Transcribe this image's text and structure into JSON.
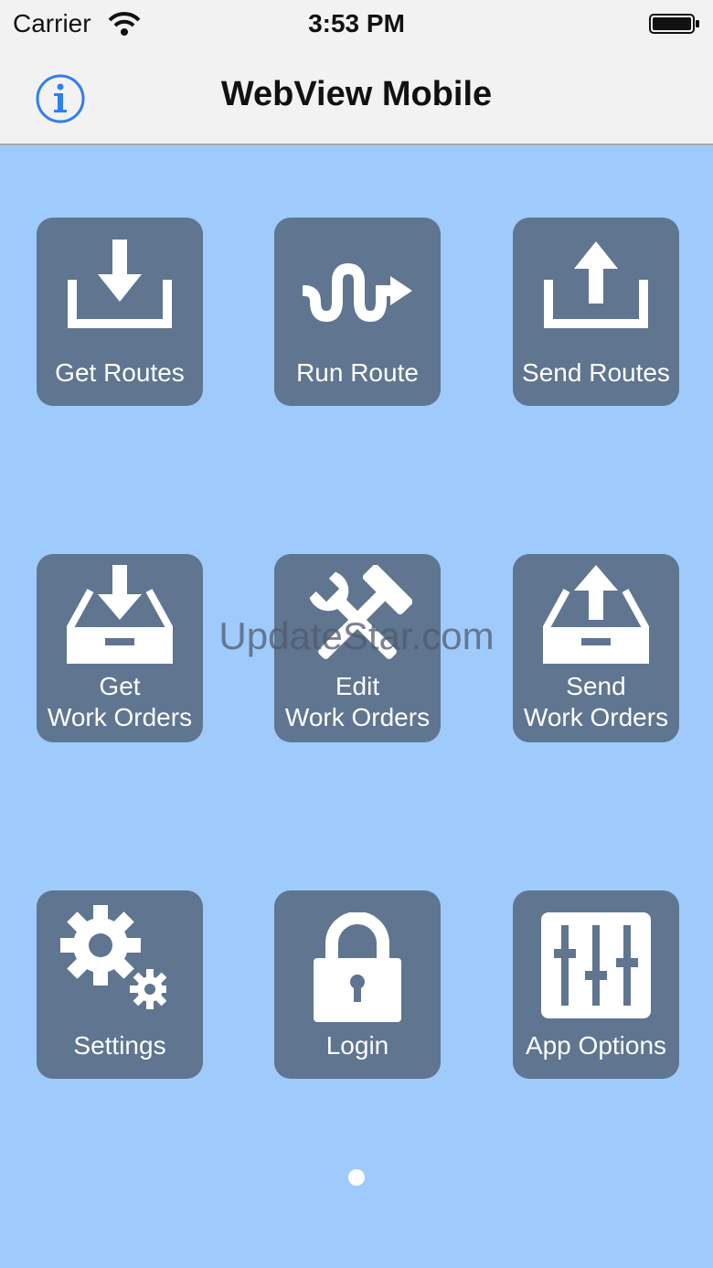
{
  "status_bar": {
    "carrier": "Carrier",
    "time": "3:53 PM",
    "wifi_icon": "wifi-icon",
    "battery_icon": "battery-icon"
  },
  "nav_bar": {
    "title": "WebView Mobile",
    "info_icon": "info-icon"
  },
  "tiles": [
    {
      "id": "get-routes",
      "line1": "Get Routes",
      "line2": "",
      "icon": "download-tray-icon"
    },
    {
      "id": "run-route",
      "line1": "Run Route",
      "line2": "",
      "icon": "route-arrow-icon"
    },
    {
      "id": "send-routes",
      "line1": "Send Routes",
      "line2": "",
      "icon": "upload-tray-icon"
    },
    {
      "id": "get-work-orders",
      "line1": "Get",
      "line2": "Work Orders",
      "icon": "inbox-download-icon"
    },
    {
      "id": "edit-work-orders",
      "line1": "Edit",
      "line2": "Work Orders",
      "icon": "tools-icon"
    },
    {
      "id": "send-work-orders",
      "line1": "Send",
      "line2": "Work Orders",
      "icon": "inbox-upload-icon"
    },
    {
      "id": "settings",
      "line1": "Settings",
      "line2": "",
      "icon": "gears-icon"
    },
    {
      "id": "login",
      "line1": "Login",
      "line2": "",
      "icon": "lock-icon"
    },
    {
      "id": "app-options",
      "line1": "App Options",
      "line2": "",
      "icon": "sliders-icon"
    }
  ],
  "watermark": "UpdateStar.com",
  "colors": {
    "background": "#9ecbfb",
    "tile": "#5f7590",
    "bar": "#f2f2f2",
    "accent": "#2e7ff0"
  }
}
